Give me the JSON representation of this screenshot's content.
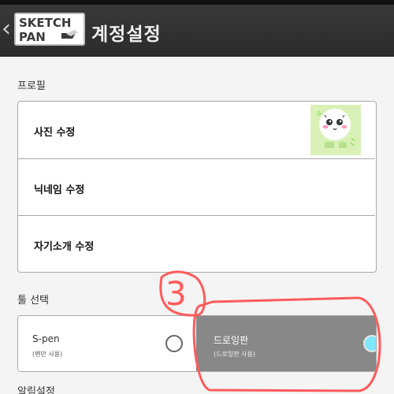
{
  "header": {
    "back_icon": "chevron-left-icon",
    "logo_line1": "SKETCH",
    "logo_line2": "PAN",
    "title": "계정설정"
  },
  "profile": {
    "section_label": "프로필",
    "items": [
      {
        "label": "사진 수정"
      },
      {
        "label": "닉네임 수정"
      },
      {
        "label": "자기소개 수정"
      }
    ]
  },
  "tools": {
    "section_label": "툴 선택",
    "options": [
      {
        "name": "S-pen",
        "sub": "(펜만 사용)",
        "selected": false
      },
      {
        "name": "드로잉판",
        "sub": "(드로잉판 사용)",
        "selected": true
      }
    ]
  },
  "annotation": {
    "number": "3",
    "color": "#ff5b5b"
  },
  "bottom": {
    "label": "알림설정"
  }
}
